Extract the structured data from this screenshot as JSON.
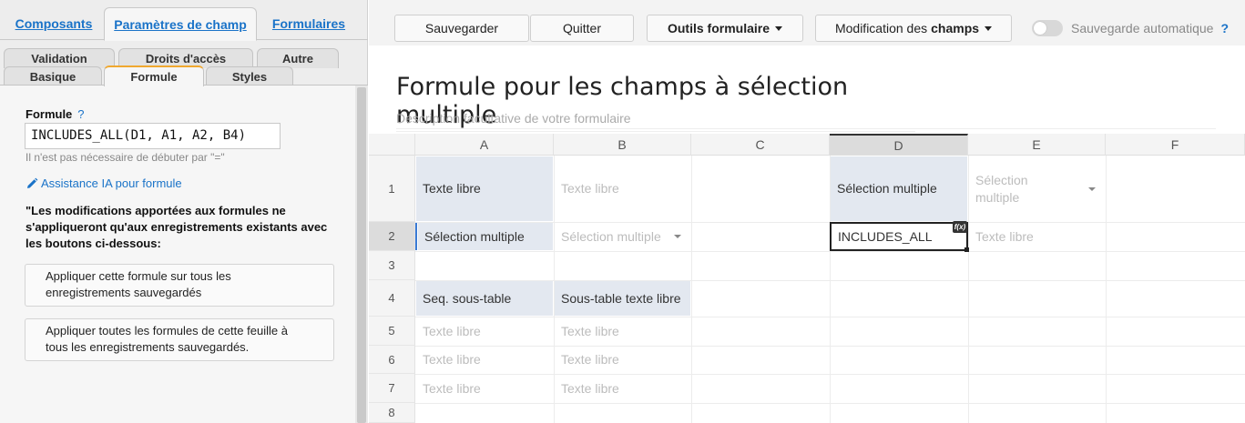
{
  "left_panel": {
    "top_tabs": [
      "Composants",
      "Paramètres de champ",
      "Formulaires"
    ],
    "sub_tabs_back": [
      "Validation",
      "Droits d'accès",
      "Autre"
    ],
    "sub_tabs_front": [
      "Basique",
      "Formule",
      "Styles"
    ],
    "formula": {
      "label": "Formule",
      "help": "?",
      "value": "INCLUDES_ALL(D1, A1, A2, B4)",
      "hint": "Il n'est pas nécessaire de débuter par \"=\""
    },
    "ai_link": "Assistance IA pour formule",
    "warning": "\"Les modifications apportées aux formules ne s'appliqueront qu'aux enregistrements existants avec les boutons ci-dessous:",
    "apply_this": "Appliquer cette formule sur tous les enregistrements sauvegardés",
    "apply_all": "Appliquer toutes les formules de cette feuille à tous les enregistrements sauvegardés."
  },
  "toolbar": {
    "save": "Sauvegarder",
    "quit": "Quitter",
    "form_tools": "Outils formulaire",
    "field_edit_prefix": "Modification des",
    "field_edit_bold": "champs",
    "autosave": "Sauvegarde automatique",
    "autosave_help": "?",
    "autosave_on": false
  },
  "form": {
    "title": "Formule pour les champs à sélection multiple",
    "description": "Description facultative de votre formulaire"
  },
  "grid": {
    "columns": [
      "A",
      "B",
      "C",
      "D",
      "E",
      "F"
    ],
    "selected_column": "D",
    "rows": [
      "1",
      "2",
      "3",
      "4",
      "5",
      "6",
      "7",
      "8"
    ],
    "selected_row": "2",
    "cells": {
      "A1": "Texte libre",
      "B1": "Texte libre",
      "D1": "Sélection multiple",
      "E1": "Sélection multiple",
      "A2": "Sélection multiple",
      "B2": "Sélection multiple",
      "D2": "INCLUDES_ALL",
      "E2": "Texte libre",
      "A4": "Seq. sous-table",
      "B4": "Sous-table texte libre",
      "A5": "Texte libre",
      "B5": "Texte libre",
      "A6": "Texte libre",
      "B6": "Texte libre",
      "A7": "Texte libre",
      "B7": "Texte libre"
    },
    "formula_badge": "f(x)"
  },
  "colors": {
    "link_blue": "#1a73c8",
    "active_tab_accent": "#f0a830",
    "label_cell_bg": "#e3e8f0",
    "placeholder_text": "#bcbcbc"
  }
}
